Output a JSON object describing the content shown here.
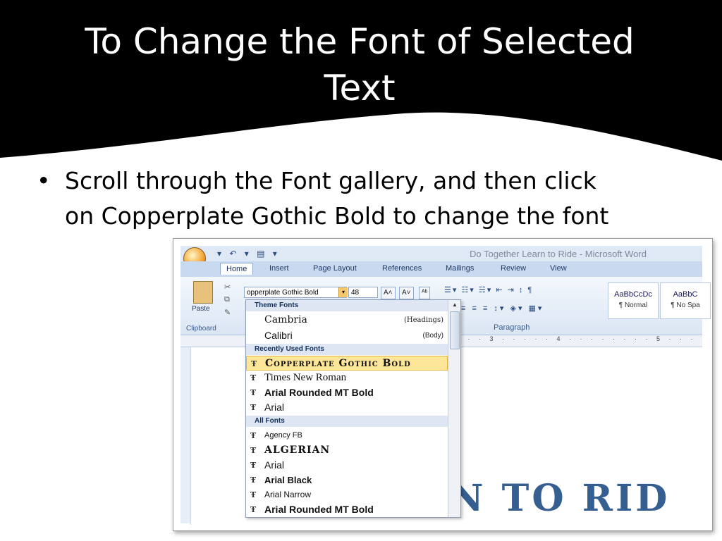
{
  "slide": {
    "title_line1": "To Change the Font of Selected",
    "title_line2": "Text",
    "bullet_line1": "Scroll through the Font gallery, and then click",
    "bullet_line2": "on Copperplate Gothic Bold to change the font"
  },
  "word": {
    "window_title": "Do Together Learn to Ride - Microsoft Word",
    "tabs": [
      "Home",
      "Insert",
      "Page Layout",
      "References",
      "Mailings",
      "Review",
      "View"
    ],
    "clipboard": {
      "paste_label": "Paste",
      "group_label": "Clipboard"
    },
    "font": {
      "name_value": "opperplate Gothic Bold",
      "size_value": "48",
      "grow_label": "A",
      "shrink_label": "A"
    },
    "paragraph_label": "Paragraph",
    "styles": [
      {
        "preview": "AaBbCcDc",
        "name": "¶ Normal"
      },
      {
        "preview": "AaBbC",
        "name": "¶ No Spa"
      }
    ],
    "ruler_text": "· · · 3 · · · · · 4 · · · · · · · · 5 · · ·",
    "document_text": "N TO RID"
  },
  "gallery": {
    "theme_header": "Theme Fonts",
    "theme_fonts": [
      {
        "name": "Cambria",
        "note": "(Headings)"
      },
      {
        "name": "Calibri",
        "note": "(Body)"
      }
    ],
    "recent_header": "Recently Used Fonts",
    "recent_fonts": [
      {
        "name": "Copperplate Gothic Bold",
        "selected": true
      },
      {
        "name": "Times New Roman"
      },
      {
        "name": "Arial Rounded MT Bold"
      },
      {
        "name": "Arial"
      }
    ],
    "all_header": "All Fonts",
    "all_fonts": [
      {
        "name": "Agency FB"
      },
      {
        "name": "ALGERIAN"
      },
      {
        "name": "Arial"
      },
      {
        "name": "Arial Black"
      },
      {
        "name": "Arial Narrow"
      },
      {
        "name": "Arial Rounded MT Bold"
      }
    ],
    "truetype_icon": "Ŧ"
  },
  "colors": {
    "band": "#000000",
    "selected_item": "#fde59a",
    "doc_text": "#365f91"
  }
}
